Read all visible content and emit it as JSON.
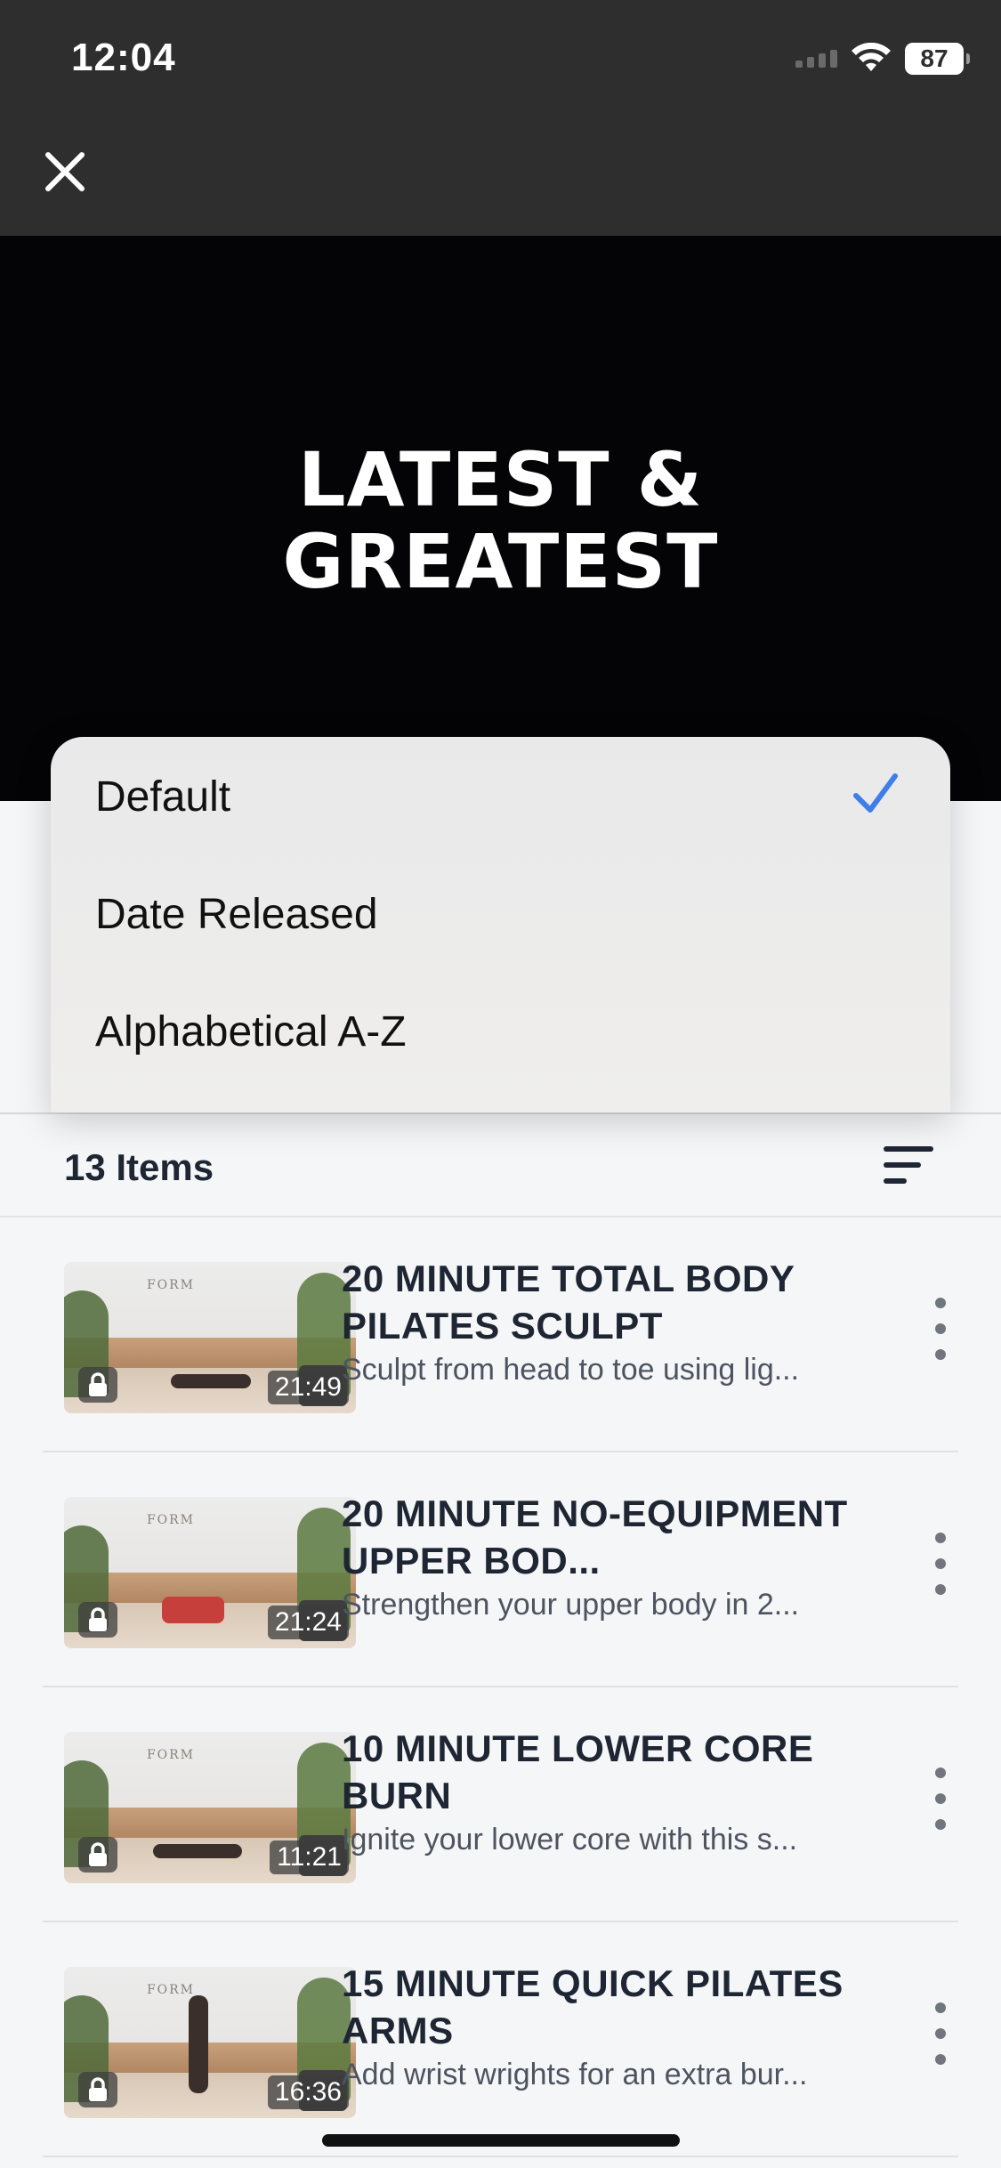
{
  "status_bar": {
    "time": "12:04",
    "battery": "87"
  },
  "hero": {
    "title": "LATEST &\nGREATEST"
  },
  "sort_menu": {
    "options": [
      {
        "label": "Default",
        "selected": true
      },
      {
        "label": "Date Released",
        "selected": false
      },
      {
        "label": "Alphabetical A-Z",
        "selected": false
      }
    ]
  },
  "toolbar": {
    "count_label": "13 Items"
  },
  "workouts": [
    {
      "title": "20 MINUTE TOTAL BODY PILATES SCULPT",
      "description": "Sculpt from head to toe using lig...",
      "duration": "21:49"
    },
    {
      "title": "20 MINUTE NO-EQUIPMENT UPPER BOD...",
      "description": "Strengthen your upper body in 2...",
      "duration": "21:24"
    },
    {
      "title": "10 MINUTE LOWER CORE BURN",
      "description": "Ignite your lower core with this s...",
      "duration": "11:21"
    },
    {
      "title": "15 MINUTE QUICK PILATES ARMS",
      "description": "Add wrist wrights for an extra bur...",
      "duration": "16:36"
    }
  ],
  "thumbnail_brand": "FORM",
  "colors": {
    "accent_check": "#3d7ee8",
    "header_bg": "#2e2e2e",
    "hero_bg": "#040406"
  }
}
